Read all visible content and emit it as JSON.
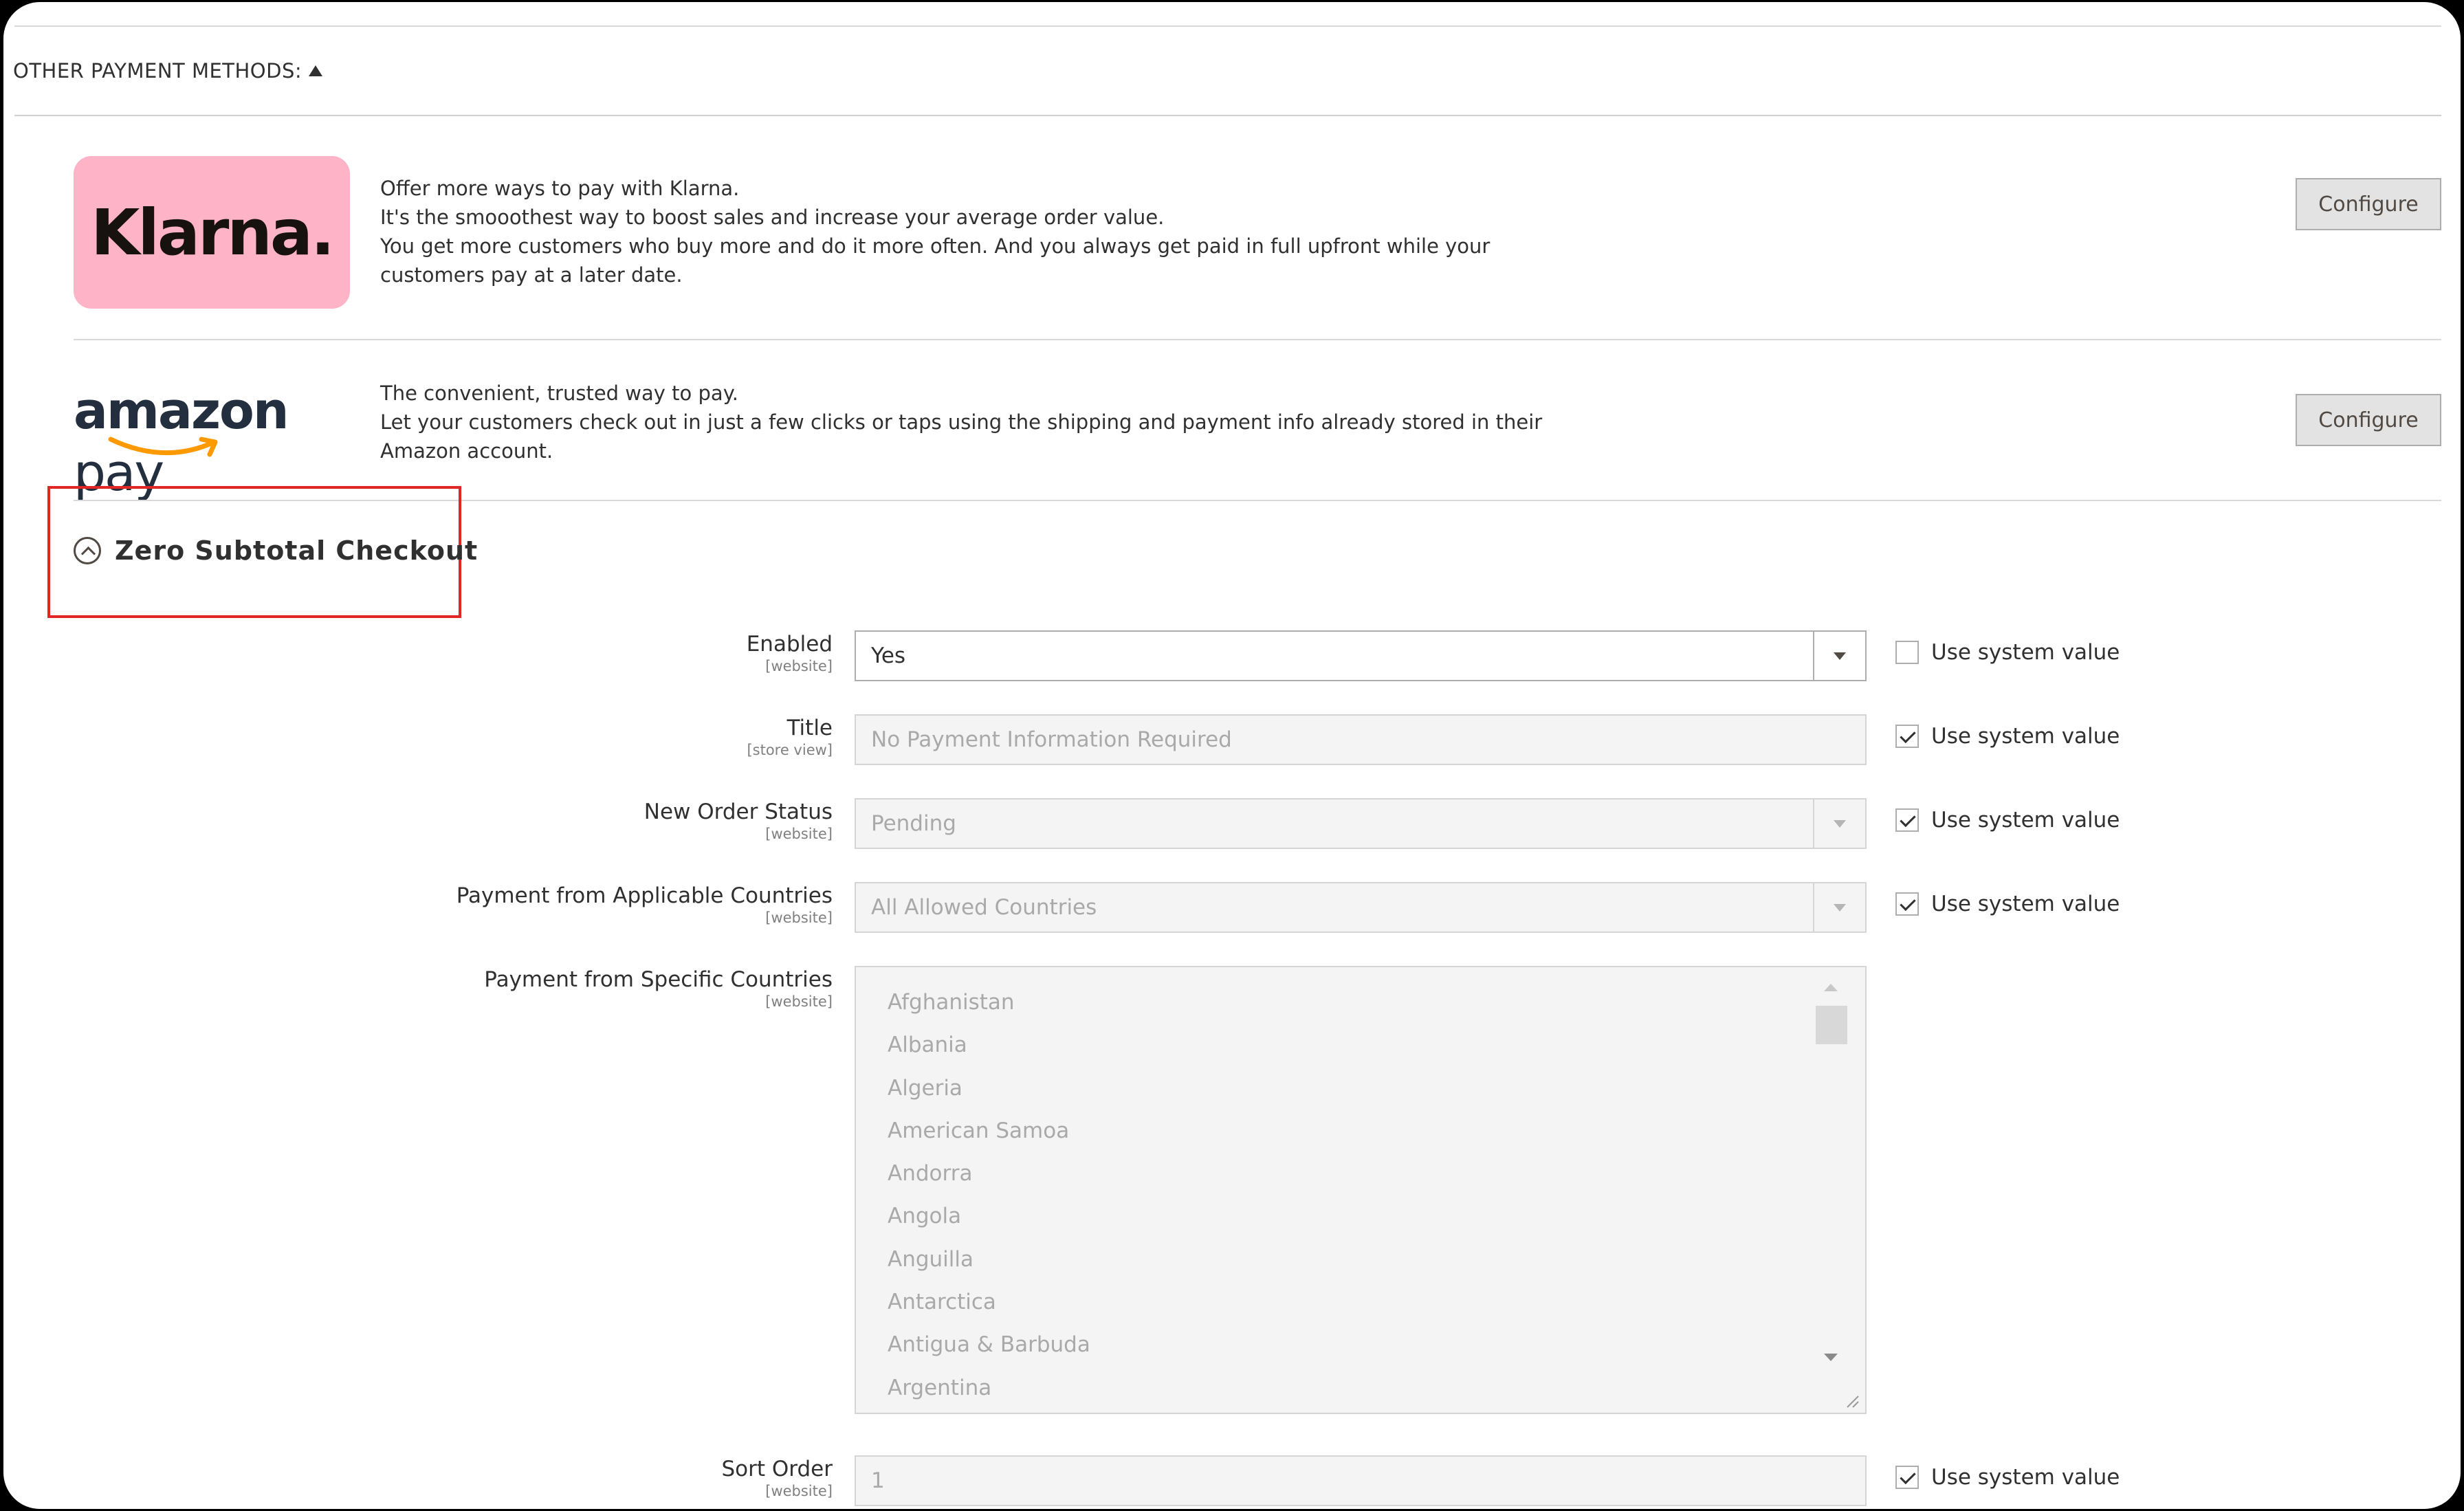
{
  "section": {
    "title": "OTHER PAYMENT METHODS:"
  },
  "methods": {
    "klarna": {
      "logo_text": "Klarna.",
      "brand_color": "#ffb3c7",
      "description": [
        "Offer more ways to pay with Klarna.",
        "It's the smooothest way to boost sales and increase your average order value.",
        "You get more customers who buy more and do it more often. And you always get paid in full upfront while your",
        "customers pay at a later date."
      ],
      "configure_label": "Configure"
    },
    "amazon": {
      "logo_text_a": "amazon",
      "logo_text_b": " pay",
      "smile_color": "#ff9900",
      "description": [
        "The convenient, trusted way to pay.",
        "Let your customers check out in just a few clicks or taps using the shipping and payment info already stored in their",
        "Amazon account."
      ],
      "configure_label": "Configure"
    }
  },
  "zero_subtotal": {
    "title": "Zero Subtotal Checkout",
    "highlight_color": "#e22626",
    "use_system_value": "Use system value",
    "fields": {
      "enabled": {
        "label": "Enabled",
        "scope": "[website]",
        "value": "Yes",
        "use_system": false
      },
      "title": {
        "label": "Title",
        "scope": "[store view]",
        "value": "No Payment Information Required",
        "use_system": true
      },
      "new_order_status": {
        "label": "New Order Status",
        "scope": "[website]",
        "value": "Pending",
        "use_system": true
      },
      "applicable_countries": {
        "label": "Payment from Applicable Countries",
        "scope": "[website]",
        "value": "All Allowed Countries",
        "use_system": true
      },
      "specific_countries": {
        "label": "Payment from Specific Countries",
        "scope": "[website]",
        "options": [
          "Afghanistan",
          "Albania",
          "Algeria",
          "American Samoa",
          "Andorra",
          "Angola",
          "Anguilla",
          "Antarctica",
          "Antigua & Barbuda",
          "Argentina"
        ]
      },
      "sort_order": {
        "label": "Sort Order",
        "scope": "[website]",
        "value": "1",
        "use_system": true
      }
    }
  }
}
